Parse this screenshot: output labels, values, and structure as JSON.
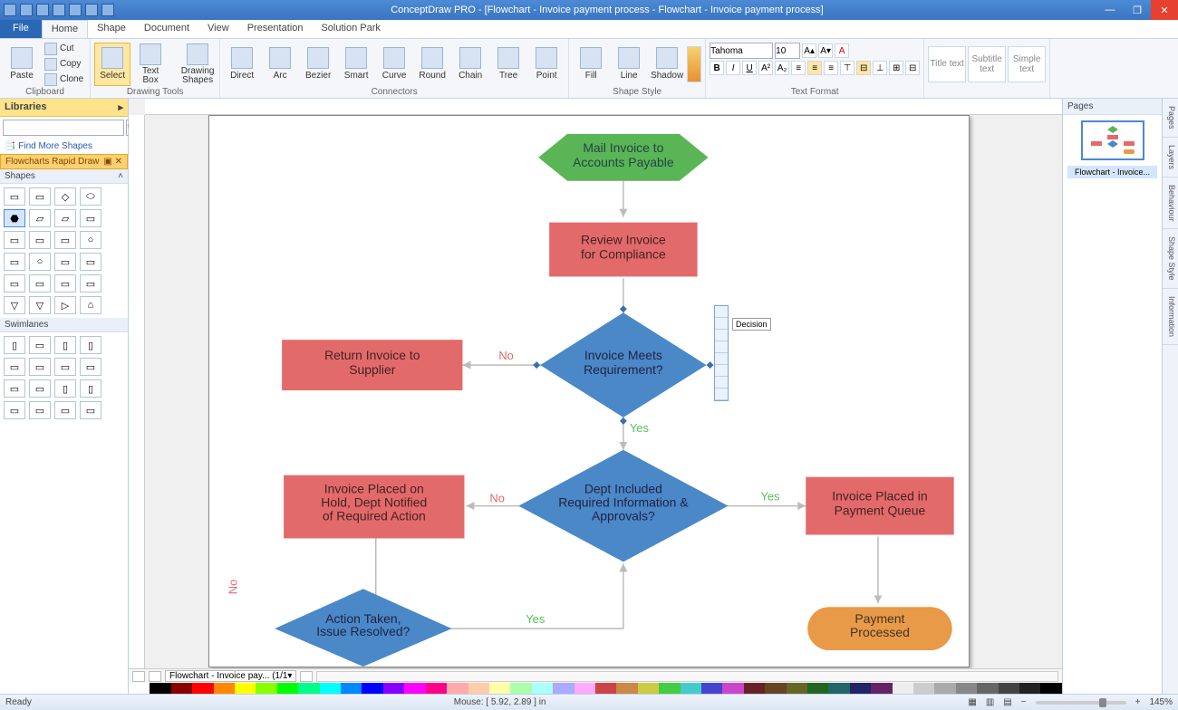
{
  "app": {
    "title": "ConceptDraw PRO - [Flowchart - Invoice payment process - Flowchart - Invoice payment process]"
  },
  "tabs": {
    "file": "File",
    "home": "Home",
    "shape": "Shape",
    "document": "Document",
    "view": "View",
    "presentation": "Presentation",
    "solution": "Solution Park"
  },
  "ribbon": {
    "clipboard": "Clipboard",
    "paste": "Paste",
    "cut": "Cut",
    "copy": "Copy",
    "clone": "Clone",
    "drawingtools": "Drawing Tools",
    "select": "Select",
    "textbox": "Text\nBox",
    "drawshapes": "Drawing\nShapes",
    "connectors": "Connectors",
    "direct": "Direct",
    "arc": "Arc",
    "bezier": "Bezier",
    "smart": "Smart",
    "curve": "Curve",
    "round": "Round",
    "chain": "Chain",
    "tree": "Tree",
    "point": "Point",
    "shapestyle": "Shape Style",
    "fill": "Fill",
    "line": "Line",
    "shadow": "Shadow",
    "textformat": "Text Format",
    "font": "Tahoma",
    "fontsize": "10",
    "titletext": "Title text",
    "subtitletext": "Subtitle text",
    "simpletext": "Simple text"
  },
  "libs": {
    "title": "Libraries",
    "find": "Find More Shapes",
    "cat": "Flowcharts Rapid Draw",
    "shapes": "Shapes",
    "swimlanes": "Swimlanes"
  },
  "rpanel": {
    "title": "Pages",
    "thumbname": "Flowchart - Invoice..."
  },
  "vtabs": [
    "Pages",
    "Layers",
    "Behaviour",
    "Shape Style",
    "Information"
  ],
  "flow": {
    "mail": "Mail Invoice to\nAccounts Payable",
    "review": "Review Invoice\nfor Compliance",
    "meets": "Invoice Meets\nRequirement?",
    "return": "Return Invoice to\nSupplier",
    "dept": "Dept Included\nRequired Information &\nApprovals?",
    "hold": "Invoice Placed on\nHold, Dept Notified\nof Required Action",
    "queue": "Invoice Placed in\nPayment Queue",
    "action": "Action Taken,\nIssue Resolved?",
    "payment": "Payment\nProcessed",
    "yes": "Yes",
    "no": "No"
  },
  "floatlbl": "Decision",
  "pagetab": "Flowchart - Invoice pay...  (1/1",
  "status": {
    "ready": "Ready",
    "mouse": "Mouse: [ 5.92, 2.89 ] in",
    "zoom": "145%"
  }
}
